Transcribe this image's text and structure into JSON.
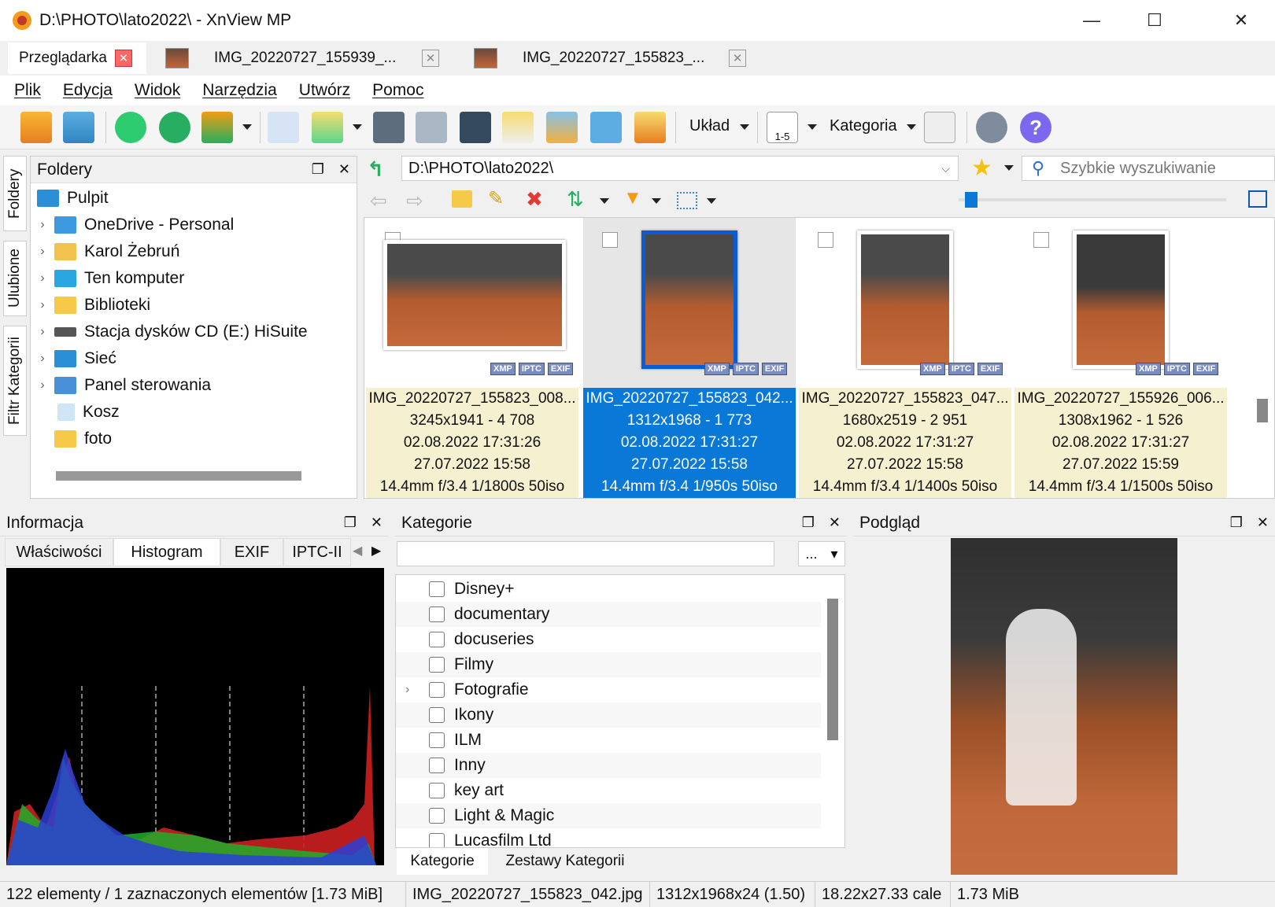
{
  "window": {
    "title": "D:\\PHOTO\\lato2022\\ - XnView MP",
    "minimize": "—",
    "maximize": "☐",
    "close": "✕"
  },
  "tabs": [
    {
      "label": "Przeglądarka"
    },
    {
      "label": "IMG_20220727_155939_..."
    },
    {
      "label": "IMG_20220727_155823_..."
    }
  ],
  "menu": [
    "Plik",
    "Edycja",
    "Widok",
    "Narzędzia",
    "Utwórz",
    "Pomoc"
  ],
  "toolbar": {
    "layout_label": "Układ",
    "category_label": "Kategoria",
    "rating_label": "1-5"
  },
  "sidetabs": [
    "Foldery",
    "Ulubione",
    "Filtr Kategorii"
  ],
  "folders": {
    "title": "Foldery",
    "items": [
      {
        "label": "Pulpit",
        "icon": "desktop-icon",
        "color": "#2a8fd6"
      },
      {
        "label": "OneDrive - Personal",
        "icon": "cloud-folder-icon",
        "color": "#3c9be0"
      },
      {
        "label": "Karol Żebruń",
        "icon": "user-folder-icon",
        "color": "#f2c14e"
      },
      {
        "label": "Ten komputer",
        "icon": "computer-icon",
        "color": "#2aa6e0"
      },
      {
        "label": "Biblioteki",
        "icon": "library-folder-icon",
        "color": "#f7c948"
      },
      {
        "label": "Stacja dysków CD (E:) HiSuite",
        "icon": "cd-drive-icon",
        "color": "#555555"
      },
      {
        "label": "Sieć",
        "icon": "network-icon",
        "color": "#2a8fd6"
      },
      {
        "label": "Panel sterowania",
        "icon": "control-panel-icon",
        "color": "#4a90d9"
      },
      {
        "label": "Kosz",
        "icon": "recycle-bin-icon",
        "color": "#cfe6f7"
      },
      {
        "label": "foto",
        "icon": "folder-icon",
        "color": "#f7c948"
      }
    ]
  },
  "address": {
    "path": "D:\\PHOTO\\lato2022\\",
    "search_placeholder": "Szybkie wyszukiwanie"
  },
  "thumbnails": [
    {
      "name": "IMG_20220727_155823_008...",
      "dims": "3245x1941 - 4 708",
      "modified": "02.08.2022 17:31:26",
      "taken": "27.07.2022 15:58",
      "exif": "14.4mm f/3.4 1/1800s 50iso",
      "selected": false
    },
    {
      "name": "IMG_20220727_155823_042...",
      "dims": "1312x1968 - 1 773",
      "modified": "02.08.2022 17:31:27",
      "taken": "27.07.2022 15:58",
      "exif": "14.4mm f/3.4 1/950s 50iso",
      "selected": true
    },
    {
      "name": "IMG_20220727_155823_047...",
      "dims": "1680x2519 - 2 951",
      "modified": "02.08.2022 17:31:27",
      "taken": "27.07.2022 15:58",
      "exif": "14.4mm f/3.4 1/1400s 50iso",
      "selected": false
    },
    {
      "name": "IMG_20220727_155926_006...",
      "dims": "1308x1962 - 1 526",
      "modified": "02.08.2022 17:31:27",
      "taken": "27.07.2022 15:59",
      "exif": "14.4mm f/3.4 1/1500s 50iso",
      "selected": false
    }
  ],
  "badges": [
    "XMP",
    "IPTC",
    "EXIF"
  ],
  "info": {
    "title": "Informacja",
    "tabs": [
      "Właściwości",
      "Histogram",
      "EXIF",
      "IPTC-II"
    ]
  },
  "categories": {
    "title": "Kategorie",
    "more_button": "...",
    "items": [
      {
        "label": "Disney+",
        "expandable": false
      },
      {
        "label": "documentary",
        "expandable": false
      },
      {
        "label": "docuseries",
        "expandable": false
      },
      {
        "label": "Filmy",
        "expandable": false
      },
      {
        "label": "Fotografie",
        "expandable": true
      },
      {
        "label": "Ikony",
        "expandable": false
      },
      {
        "label": "ILM",
        "expandable": false
      },
      {
        "label": "Inny",
        "expandable": false
      },
      {
        "label": "key art",
        "expandable": false
      },
      {
        "label": "Light & Magic",
        "expandable": false
      },
      {
        "label": "Lucasfilm Ltd",
        "expandable": false
      }
    ],
    "tabs": [
      "Kategorie",
      "Zestawy Kategorii"
    ]
  },
  "preview": {
    "title": "Podgląd"
  },
  "status": {
    "count": "122 elementy / 1 zaznaczonych elementów [1.73 MiB]",
    "file": "IMG_20220727_155823_042.jpg",
    "resolution": "1312x1968x24 (1.50)",
    "print_size": "18.22x27.33 cale",
    "size": "1.73 MiB"
  },
  "colors": {
    "selection": "#0a78d7",
    "accent": "#0b5bd6",
    "info_bg": "#f4f0d0"
  }
}
